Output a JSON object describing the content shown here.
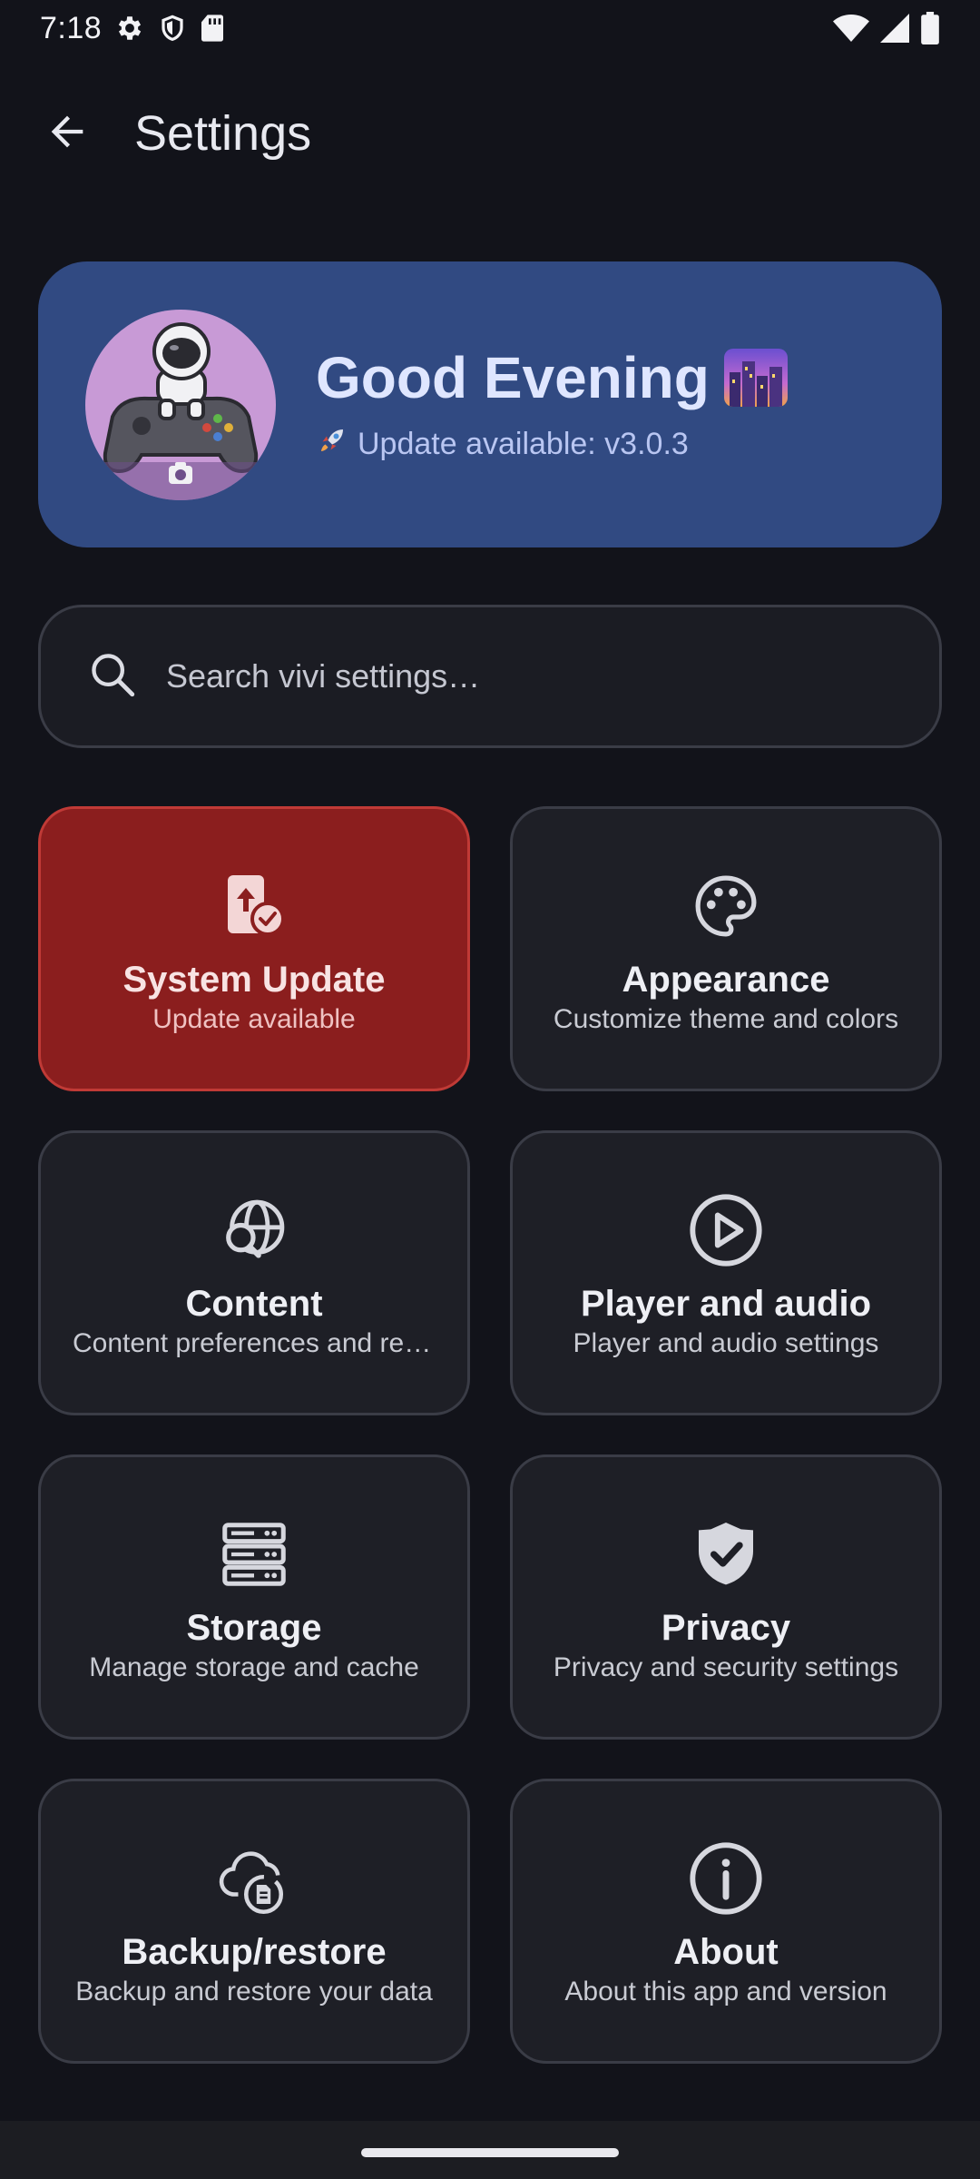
{
  "status_bar": {
    "time": "7:18",
    "left_icons": [
      "gear-icon",
      "shield-icon",
      "sd-card-icon"
    ],
    "right_icons": [
      "wifi-icon",
      "signal-icon",
      "battery-icon"
    ]
  },
  "app_bar": {
    "back_icon": "arrow-back-icon",
    "title": "Settings"
  },
  "greeting": {
    "title": "Good Evening",
    "title_emoji": "cityscape-at-dusk-emoji",
    "subtitle_emoji": "rocket-emoji",
    "subtitle": "Update available: v3.0.3",
    "avatar": "astronaut-on-gamepad-avatar",
    "avatar_badge_icon": "camera-icon"
  },
  "search": {
    "placeholder": "Search vivi settings…",
    "value": "",
    "icon": "search-icon"
  },
  "tiles": [
    {
      "title": "System Update",
      "subtitle": "Update available",
      "icon": "phone-update-icon",
      "highlight": true
    },
    {
      "title": "Appearance",
      "subtitle": "Customize theme and colors",
      "icon": "palette-icon"
    },
    {
      "title": "Content",
      "subtitle": "Content preferences and region",
      "icon": "globe-search-icon"
    },
    {
      "title": "Player and audio",
      "subtitle": "Player and audio settings",
      "icon": "play-circle-icon"
    },
    {
      "title": "Storage",
      "subtitle": "Manage storage and cache",
      "icon": "storage-icon"
    },
    {
      "title": "Privacy",
      "subtitle": "Privacy and security settings",
      "icon": "shield-check-icon"
    },
    {
      "title": "Backup/restore",
      "subtitle": "Backup and restore your data",
      "icon": "cloud-backup-icon"
    },
    {
      "title": "About",
      "subtitle": "About this app and version",
      "icon": "info-icon"
    }
  ],
  "colors": {
    "background": "#12131a",
    "greeting_card": "#314a82",
    "highlight_tile": "#8b1e1e",
    "tile": "#1e1f26"
  }
}
